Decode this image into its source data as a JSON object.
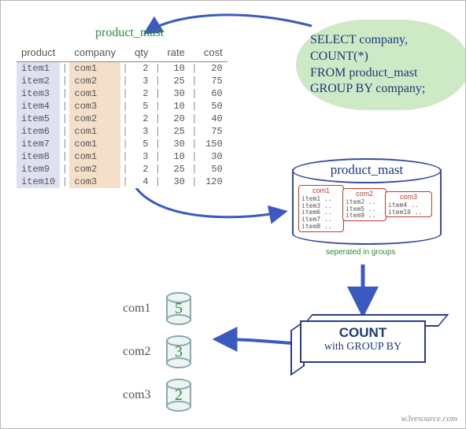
{
  "table": {
    "title": "product_mast",
    "headers": [
      "product",
      "company",
      "qty",
      "rate",
      "cost"
    ],
    "rows": [
      {
        "product": "item1",
        "company": "com1",
        "qty": 2,
        "rate": 10,
        "cost": 20
      },
      {
        "product": "item2",
        "company": "com2",
        "qty": 3,
        "rate": 25,
        "cost": 75
      },
      {
        "product": "item3",
        "company": "com1",
        "qty": 2,
        "rate": 30,
        "cost": 60
      },
      {
        "product": "item4",
        "company": "com3",
        "qty": 5,
        "rate": 10,
        "cost": 50
      },
      {
        "product": "item5",
        "company": "com2",
        "qty": 2,
        "rate": 20,
        "cost": 40
      },
      {
        "product": "item6",
        "company": "com1",
        "qty": 3,
        "rate": 25,
        "cost": 75
      },
      {
        "product": "item7",
        "company": "com1",
        "qty": 5,
        "rate": 30,
        "cost": 150
      },
      {
        "product": "item8",
        "company": "com1",
        "qty": 3,
        "rate": 10,
        "cost": 30
      },
      {
        "product": "item9",
        "company": "com2",
        "qty": 2,
        "rate": 25,
        "cost": 50
      },
      {
        "product": "item10",
        "company": "com3",
        "qty": 4,
        "rate": 30,
        "cost": 120
      }
    ]
  },
  "sql": {
    "line1": "SELECT company,",
    "line2": "COUNT(*)",
    "line3": "FROM product_mast",
    "line4": "GROUP BY company;"
  },
  "grouped": {
    "title": "product_mast",
    "caption": "seperated in groups",
    "groups": [
      {
        "name": "com1",
        "items": [
          "item1 ..",
          "item3 ..",
          "item6 ..",
          "item7 ..",
          "item8 .."
        ]
      },
      {
        "name": "com2",
        "items": [
          "item2 ..",
          "item5 ..",
          "item9 .."
        ]
      },
      {
        "name": "com3",
        "items": [
          "item4 ..",
          "item10 .."
        ]
      }
    ]
  },
  "countbox": {
    "line1": "COUNT",
    "line2": "with GROUP BY"
  },
  "results": [
    {
      "label": "com1",
      "value": 5
    },
    {
      "label": "com2",
      "value": 3
    },
    {
      "label": "com3",
      "value": 2
    }
  ],
  "footer": "w3resource.com"
}
